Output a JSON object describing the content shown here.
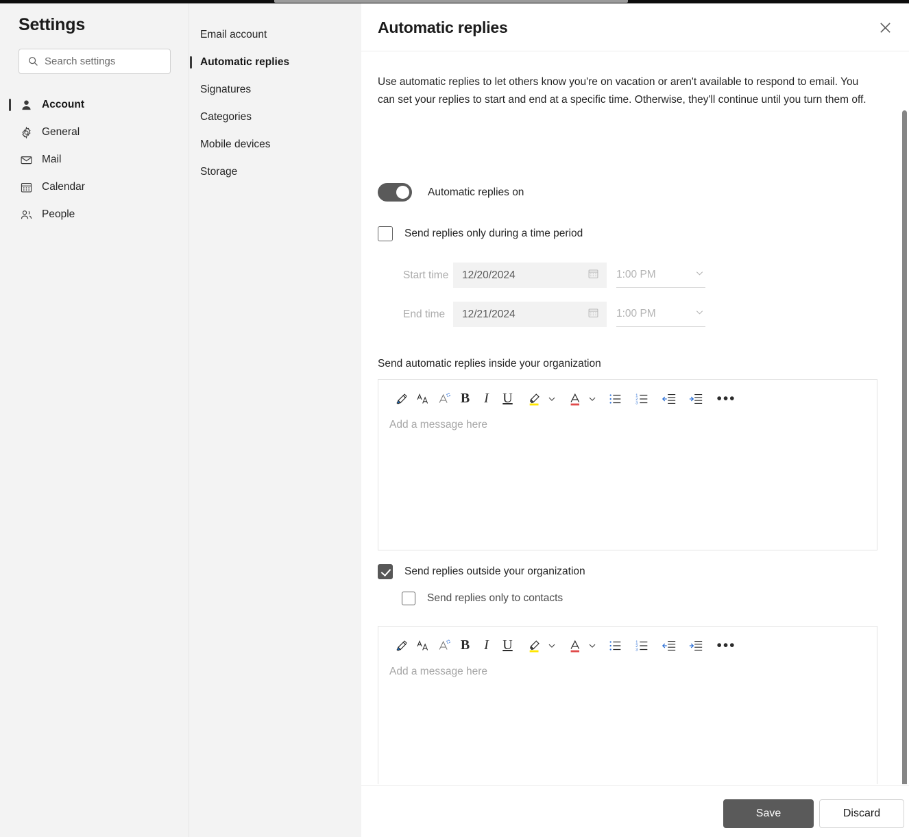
{
  "window": {
    "chrome_strip_color": "#0d0d0d",
    "chrome_tab_color": "#9b9b9b"
  },
  "sidebar": {
    "title": "Settings",
    "search": {
      "placeholder": "Search settings",
      "value": "",
      "icon": "search-icon"
    },
    "items": [
      {
        "label": "Account",
        "icon": "person-icon",
        "selected": true
      },
      {
        "label": "General",
        "icon": "gear-icon",
        "selected": false
      },
      {
        "label": "Mail",
        "icon": "envelope-icon",
        "selected": false
      },
      {
        "label": "Calendar",
        "icon": "calendar-icon",
        "selected": false
      },
      {
        "label": "People",
        "icon": "people-icon",
        "selected": false
      }
    ]
  },
  "subnav": {
    "items": [
      {
        "label": "Email account",
        "selected": false
      },
      {
        "label": "Automatic replies",
        "selected": true
      },
      {
        "label": "Signatures",
        "selected": false
      },
      {
        "label": "Categories",
        "selected": false
      },
      {
        "label": "Mobile devices",
        "selected": false
      },
      {
        "label": "Storage",
        "selected": false
      }
    ]
  },
  "panel": {
    "title": "Automatic replies",
    "close_icon": "close-icon",
    "intro": "Use automatic replies to let others know you're on vacation or aren't available to respond to email. You can set your replies to start and end at a specific time. Otherwise, they'll continue until you turn them off.",
    "toggle": {
      "label": "Automatic replies on",
      "on": true,
      "track_color": "#5a5a5a"
    },
    "time_period": {
      "checkbox_label": "Send replies only during a time period",
      "checked": false,
      "start": {
        "caption": "Start time",
        "date": "12/20/2024",
        "time": "1:00 PM",
        "calendar_icon": "calendar-icon",
        "chevron_icon": "chevron-down-icon"
      },
      "end": {
        "caption": "End time",
        "date": "12/21/2024",
        "time": "1:00 PM",
        "calendar_icon": "calendar-icon",
        "chevron_icon": "chevron-down-icon"
      }
    },
    "inside": {
      "section_label": "Send automatic replies inside your organization",
      "editor_placeholder": "Add a message here",
      "editor_value": ""
    },
    "outside": {
      "checkbox_label": "Send replies outside your organization",
      "checked": true,
      "contacts_checkbox_label": "Send replies only to contacts",
      "contacts_checked": false,
      "editor_placeholder": "Add a message here",
      "editor_value": ""
    },
    "toolbar": {
      "buttons": [
        {
          "name": "format-painter-icon",
          "title": "Format painter"
        },
        {
          "name": "grow-font-icon",
          "title": "Increase font size"
        },
        {
          "name": "clear-format-icon",
          "title": "Clear formatting"
        },
        {
          "name": "bold-icon",
          "title": "Bold",
          "glyph": "B"
        },
        {
          "name": "italic-icon",
          "title": "Italic",
          "glyph": "I"
        },
        {
          "name": "underline-icon",
          "title": "Underline",
          "glyph": "U"
        },
        {
          "name": "highlight-icon",
          "title": "Highlight",
          "accent": "#ffe600"
        },
        {
          "name": "font-color-icon",
          "title": "Font color",
          "accent": "#e04b4b"
        },
        {
          "name": "bulleted-list-icon",
          "title": "Bulleted list"
        },
        {
          "name": "numbered-list-icon",
          "title": "Numbered list"
        },
        {
          "name": "decrease-indent-icon",
          "title": "Decrease indent"
        },
        {
          "name": "increase-indent-icon",
          "title": "Increase indent"
        },
        {
          "name": "more-options-icon",
          "title": "More options",
          "glyph": "•••"
        }
      ]
    },
    "footer": {
      "save_label": "Save",
      "discard_label": "Discard",
      "save_bg": "#5a5a5a"
    }
  },
  "scrollbar": {
    "thumb_color": "#868686"
  }
}
